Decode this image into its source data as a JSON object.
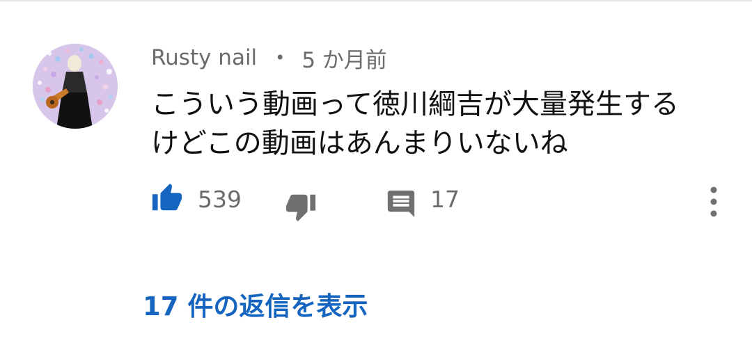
{
  "comment": {
    "author": "Rusty nail",
    "separator": "•",
    "time": "5 か月前",
    "text_lines": [
      "こういう動画って徳川綱吉が大量発生する",
      "けどこの動画はあんまりいないね"
    ],
    "likes": "539",
    "replies_count": "17",
    "view_replies": "17 件の返信を表示"
  },
  "icons": {
    "like": "thumbs-up-icon",
    "dislike": "thumbs-down-icon",
    "reply": "comment-icon",
    "more": "more-vert-icon"
  },
  "colors": {
    "like_active": "#1565c0",
    "link": "#1565c0",
    "muted": "#6b6b6b",
    "icon_gray": "#707070",
    "text": "#111111"
  }
}
